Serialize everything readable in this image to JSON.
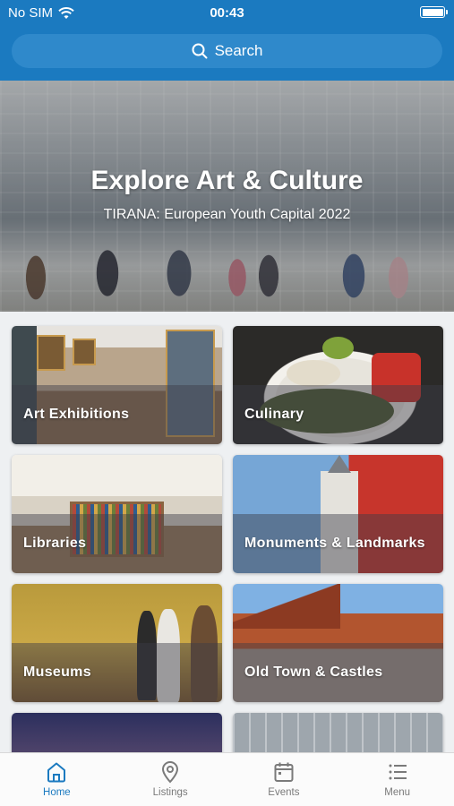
{
  "status_bar": {
    "carrier": "No SIM",
    "time": "00:43"
  },
  "search": {
    "label": "Search"
  },
  "hero": {
    "title": "Explore Art & Culture",
    "subtitle": "TIRANA: European Youth Capital 2022"
  },
  "categories": [
    {
      "label": "Art Exhibitions"
    },
    {
      "label": "Culinary"
    },
    {
      "label": "Libraries"
    },
    {
      "label": "Monuments & Landmarks"
    },
    {
      "label": "Museums"
    },
    {
      "label": "Old Town & Castles"
    }
  ],
  "tabs": [
    {
      "label": "Home",
      "icon": "home-icon",
      "active": true
    },
    {
      "label": "Listings",
      "icon": "location-pin-icon"
    },
    {
      "label": "Events",
      "icon": "calendar-icon"
    },
    {
      "label": "Menu",
      "icon": "menu-list-icon"
    }
  ],
  "colors": {
    "primary": "#1b7ac0",
    "tab_inactive": "#7a7a7a"
  }
}
